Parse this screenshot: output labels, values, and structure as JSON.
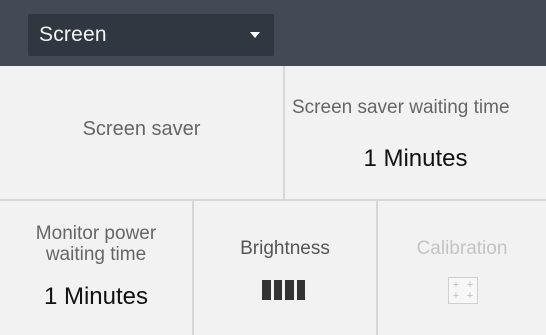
{
  "header": {
    "dropdown": {
      "selected": "Screen"
    }
  },
  "tiles": {
    "screen_saver": {
      "label": "Screen saver"
    },
    "screen_saver_waiting_time": {
      "label": "Screen saver waiting time",
      "value": "1 Minutes"
    },
    "monitor_power_waiting_time": {
      "label_line1": "Monitor power",
      "label_line2": "waiting time",
      "value": "1 Minutes"
    },
    "brightness": {
      "label": "Brightness",
      "icon": "brightness-bars-icon"
    },
    "calibration": {
      "label": "Calibration",
      "icon": "calibration-crosshair-icon",
      "enabled": false
    }
  }
}
